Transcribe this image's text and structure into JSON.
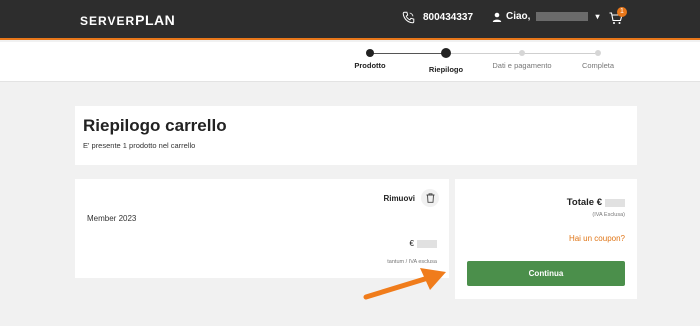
{
  "header": {
    "logo_left": "SERVER",
    "logo_right": "PLAN",
    "phone": "800434337",
    "user_greeting": "Ciao,",
    "cart_count": "1",
    "icons": [
      "phone-icon",
      "user-icon",
      "caret-down-icon",
      "cart-icon"
    ],
    "accent_color": "#e8771a",
    "bar_color": "#2d2d2d"
  },
  "stepper": {
    "steps": [
      {
        "label": "Prodotto",
        "state": "done"
      },
      {
        "label": "Riepilogo",
        "state": "current"
      },
      {
        "label": "Dati e pagamento",
        "state": "todo"
      },
      {
        "label": "Completa",
        "state": "todo"
      }
    ]
  },
  "summary": {
    "title": "Riepilogo carrello",
    "subtitle": "E' presente 1 prodotto nel carrello"
  },
  "cart_item": {
    "name": "Member 2023",
    "remove_label": "Rimuovi",
    "price_symbol": "€",
    "price_note": "tantum / IVA esclusa"
  },
  "totals": {
    "total_label": "Totale €",
    "vat_note": "(IVA Esclusa)",
    "coupon_label": "Hai un coupon?",
    "continue_label": "Continua",
    "coupon_color": "#e07516",
    "button_color": "#4b8f4b"
  }
}
